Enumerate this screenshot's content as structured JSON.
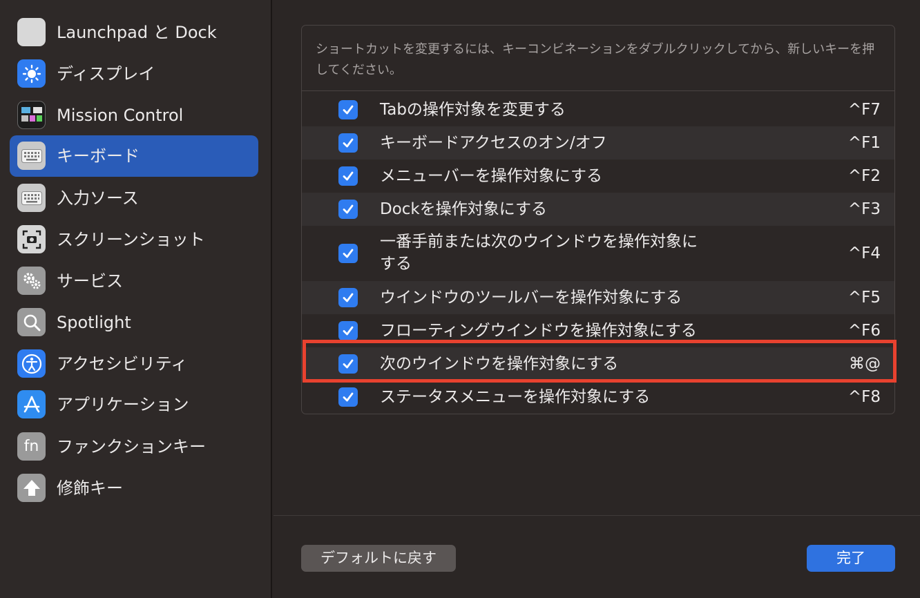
{
  "sidebar": {
    "items": [
      {
        "label": "Launchpad と Dock",
        "icon": "launchpad-icon"
      },
      {
        "label": "ディスプレイ",
        "icon": "display-sun-icon"
      },
      {
        "label": "Mission Control",
        "icon": "mission-control-icon"
      },
      {
        "label": "キーボード",
        "icon": "keyboard-icon",
        "selected": true
      },
      {
        "label": "入力ソース",
        "icon": "keyboard-icon"
      },
      {
        "label": "スクリーンショット",
        "icon": "camera-icon"
      },
      {
        "label": "サービス",
        "icon": "gears-icon"
      },
      {
        "label": "Spotlight",
        "icon": "search-icon"
      },
      {
        "label": "アクセシビリティ",
        "icon": "accessibility-icon"
      },
      {
        "label": "アプリケーション",
        "icon": "app-store-icon"
      },
      {
        "label": "ファンクションキー",
        "icon": "fn-icon",
        "icon_text": "fn"
      },
      {
        "label": "修飾キー",
        "icon": "up-arrow-icon"
      }
    ]
  },
  "panel": {
    "instructions": "ショートカットを変更するには、キーコンビネーションをダブルクリックしてから、新しいキーを押してください。",
    "shortcuts": [
      {
        "label": "Tabの操作対象を変更する",
        "key": "^F7",
        "checked": true
      },
      {
        "label": "キーボードアクセスのオン/オフ",
        "key": "^F1",
        "checked": true
      },
      {
        "label": "メニューバーを操作対象にする",
        "key": "^F2",
        "checked": true
      },
      {
        "label": "Dockを操作対象にする",
        "key": "^F3",
        "checked": true
      },
      {
        "label": "一番手前または次のウインドウを操作対象に",
        "label2": "する",
        "key": "^F4",
        "checked": true
      },
      {
        "label": "ウインドウのツールバーを操作対象にする",
        "key": "^F5",
        "checked": true
      },
      {
        "label": "フローティングウインドウを操作対象にする",
        "key": "^F6",
        "checked": true
      },
      {
        "label": "次のウインドウを操作対象にする",
        "key": "⌘@",
        "checked": true
      },
      {
        "label": "ステータスメニューを操作対象にする",
        "key": "^F8",
        "checked": true
      }
    ]
  },
  "buttons": {
    "restore_defaults": "デフォルトに戻す",
    "done": "完了"
  },
  "colors": {
    "accent": "#2f7cf0",
    "selected_sidebar": "#2a5cb8",
    "highlight_box": "#e8422f"
  }
}
